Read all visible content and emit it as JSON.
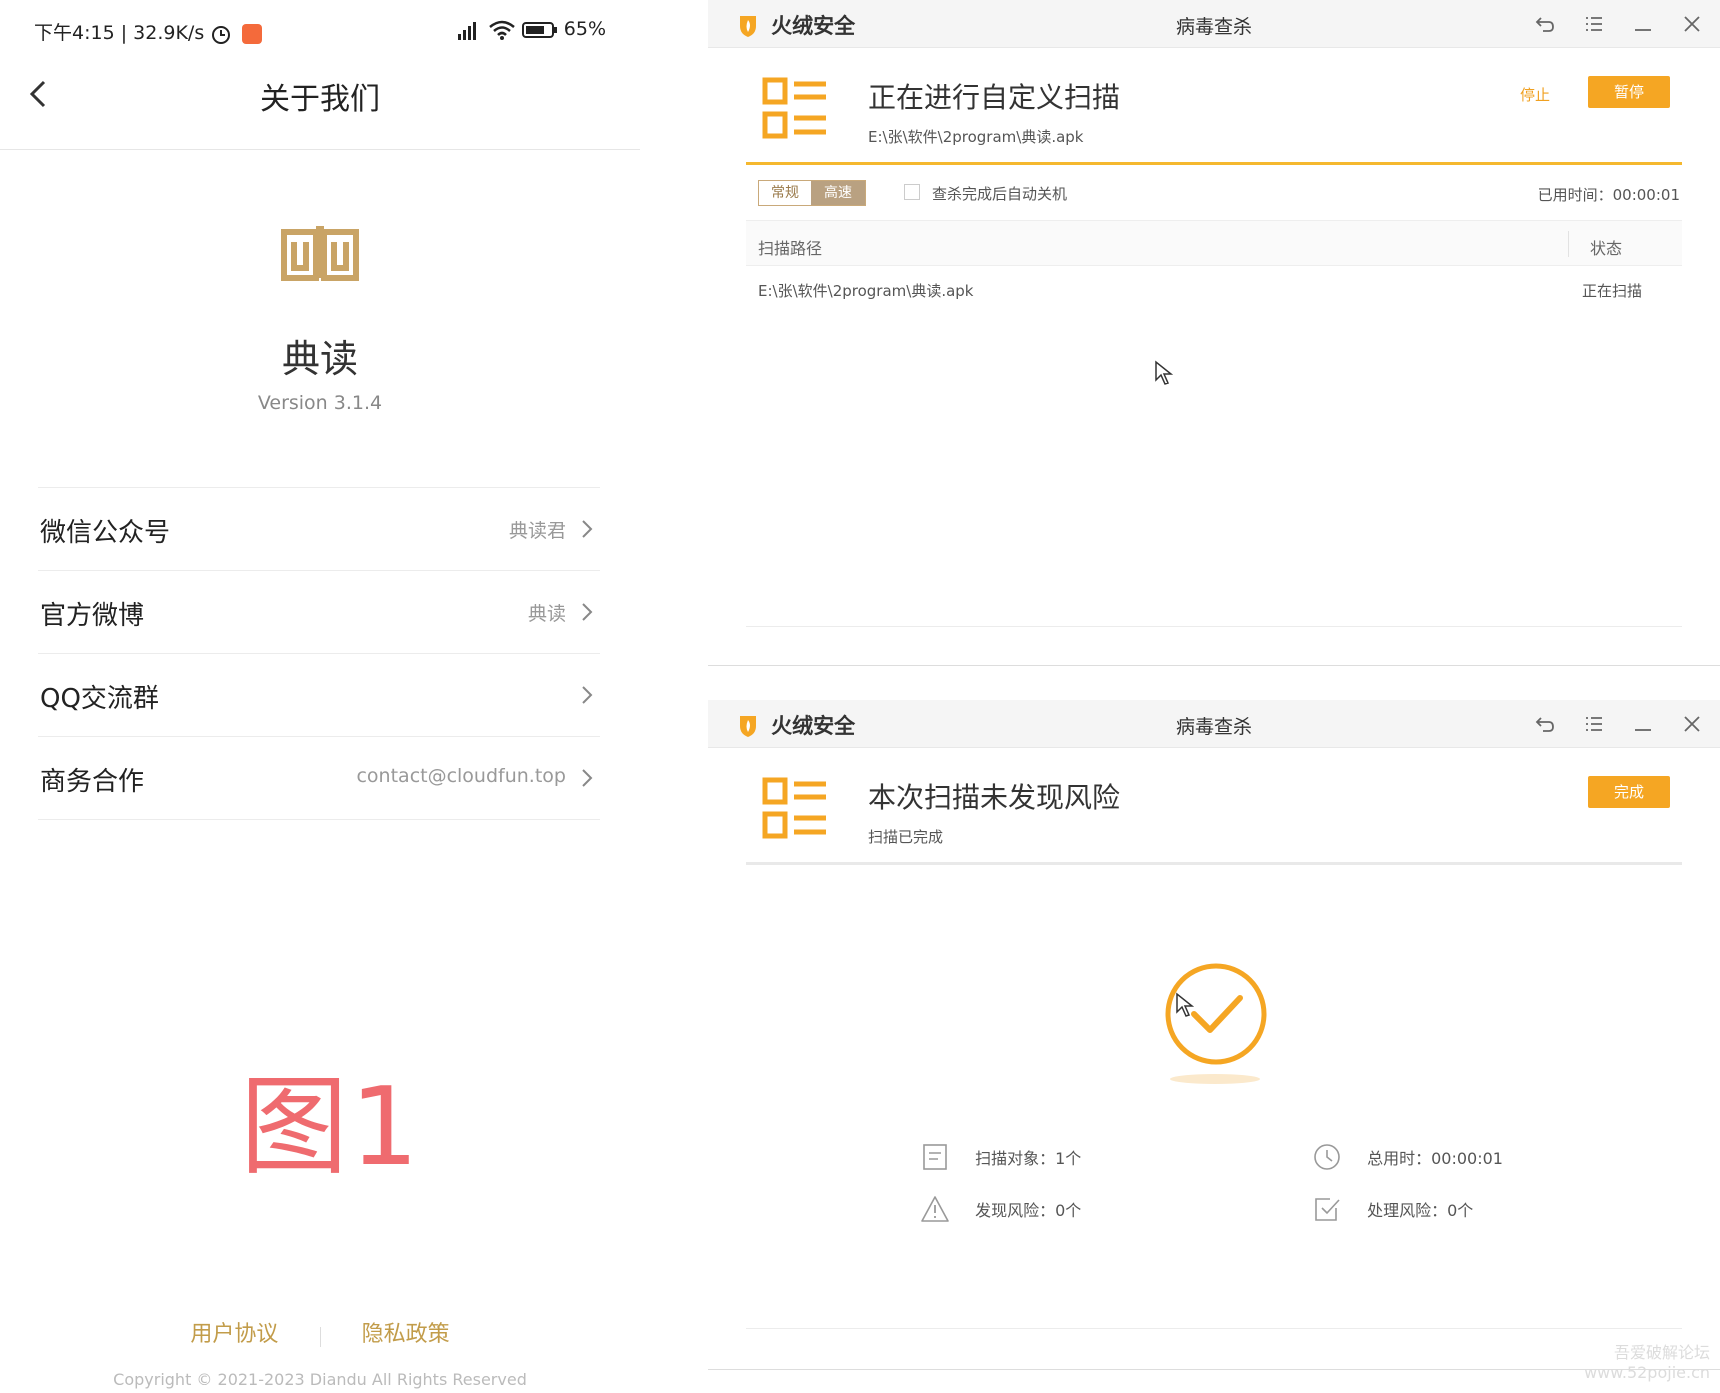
{
  "phone": {
    "status": {
      "left": "下午4:15 | 32.9K/s",
      "right": "65%"
    },
    "title": "关于我们",
    "app_name": "典读",
    "version": "Version 3.1.4",
    "menu": [
      {
        "label": "微信公众号",
        "value": "典读君"
      },
      {
        "label": "官方微博",
        "value": "典读"
      },
      {
        "label": "QQ交流群",
        "value": ""
      },
      {
        "label": "商务合作",
        "value": "contact@cloudfun.top"
      }
    ],
    "figure_label": "图1",
    "footer": {
      "user_agreement": "用户协议",
      "privacy_policy": "隐私政策"
    },
    "copyright": "Copyright © 2021-2023 Diandu All Rights Reserved",
    "colors": {
      "accent": "#c29c4a",
      "figure_label": "#ef6b6f"
    }
  },
  "win1": {
    "brand": "火绒安全",
    "title": "病毒查杀",
    "heading": "正在进行自定义扫描",
    "subtitle": "E:\\张\\软件\\2program\\典读.apk",
    "stop": "停止",
    "pause": "暂停",
    "mode_normal": "常规",
    "mode_fast": "高速",
    "auto_shutdown": "查杀完成后自动关机",
    "elapsed": "已用时间：00:00:01",
    "table": {
      "col_path": "扫描路径",
      "col_status": "状态",
      "rows": [
        {
          "path": "E:\\张\\软件\\2program\\典读.apk",
          "status": "正在扫描"
        }
      ]
    }
  },
  "win2": {
    "brand": "火绒安全",
    "title": "病毒查杀",
    "heading": "本次扫描未发现风险",
    "subtitle": "扫描已完成",
    "done": "完成",
    "stats": {
      "objects": "扫描对象：1个",
      "total_time": "总用时：00:00:01",
      "risks_found": "发现风险：0个",
      "risks_handled": "处理风险：0个"
    }
  },
  "watermark": {
    "line1": "吾爱破解论坛",
    "line2": "www.52pojie.cn"
  },
  "colors": {
    "huorong_orange": "#f5a623"
  }
}
